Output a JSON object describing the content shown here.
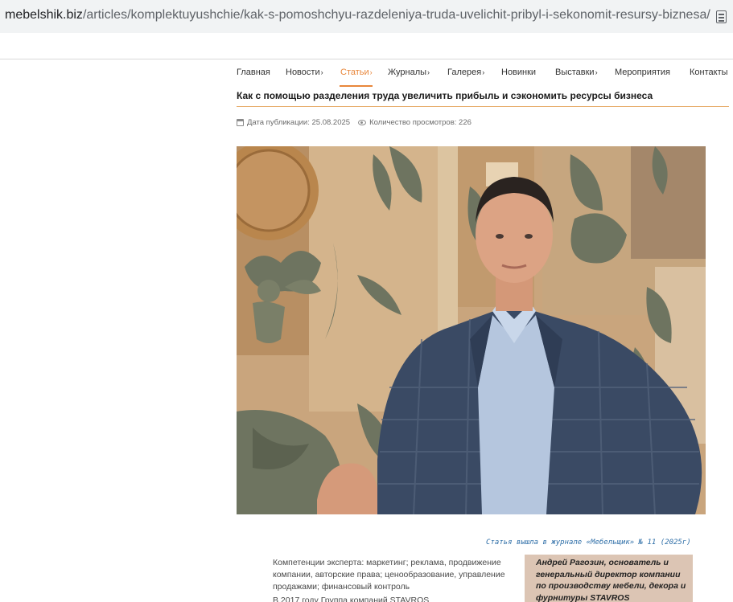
{
  "browser": {
    "url_host": "mebelshik.biz",
    "url_path": "/articles/komplektuyushchie/kak-s-pomoshchyu-razdeleniya-truda-uvelichit-pribyl-i-sekonomit-resursy-biznesa/"
  },
  "nav": {
    "items": [
      {
        "label": "Главная",
        "has_arrow": false
      },
      {
        "label": "Новости",
        "has_arrow": true
      },
      {
        "label": "Статьи",
        "has_arrow": true,
        "active": true
      },
      {
        "label": "Журналы",
        "has_arrow": true
      },
      {
        "label": "Галерея",
        "has_arrow": true
      },
      {
        "label": "Новинки",
        "has_arrow": false
      },
      {
        "label": "Выставки",
        "has_arrow": true
      },
      {
        "label": "Мероприятия",
        "has_arrow": false
      },
      {
        "label": "Контакты",
        "has_arrow": false
      }
    ],
    "arrow_glyph": "›",
    "accent_color": "#e8863a"
  },
  "article": {
    "title": "Как с помощью разделения труда увеличить прибыль и сэкономить ресурсы бизнеса",
    "publish_label": "Дата публикации: 25.08.2025",
    "views_label": "Количество просмотров: 226",
    "journal_note": "Статья вышла в журнале «Мебельщик» № 11 (2025г)",
    "competence": "Компетенции эксперта: маркетинг; реклама, продвижение компании, авторские права; ценообразование, управление продажами; финансовый контроль",
    "body_start": "В 2017 году Группа компаний STAVROS",
    "caption": "Андрей Рагозин, основатель и генеральный директор компании по производству мебели, декора и фурнитуры STAVROS"
  },
  "icons": {
    "calendar": "calendar-icon",
    "views": "eye-icon",
    "reader": "reader-mode-icon"
  }
}
